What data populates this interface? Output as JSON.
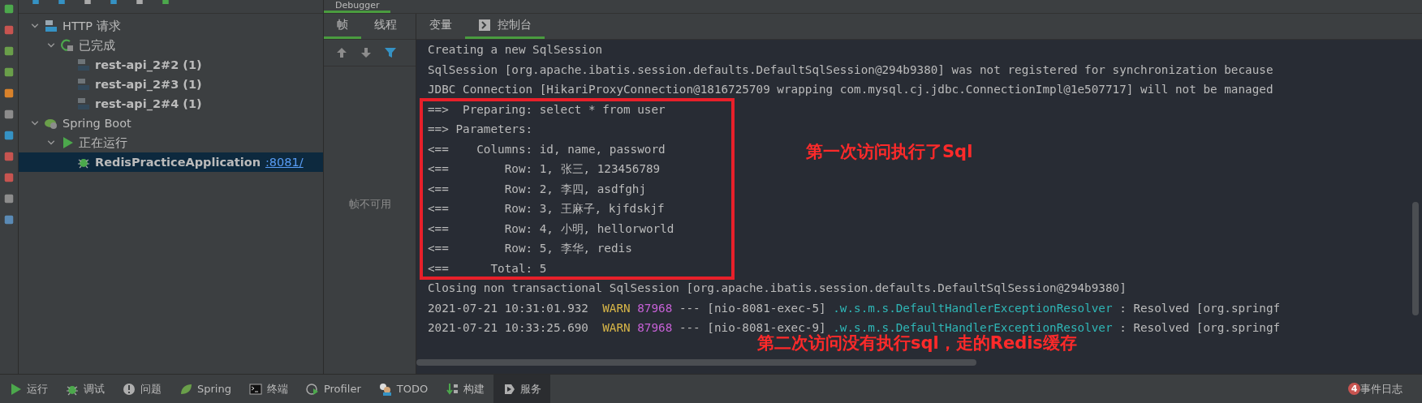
{
  "debugger_tab": {
    "label": "Debugger",
    "selected": true
  },
  "services_tree": [
    {
      "label": "HTTP 请求",
      "kind": "api",
      "expanded": true,
      "selected": false,
      "children": [
        {
          "label": "已完成",
          "kind": "done",
          "expanded": true,
          "selected": false,
          "children": [
            {
              "label": "rest-api_2#2 (1)",
              "kind": "request",
              "selected": false
            },
            {
              "label": "rest-api_2#3 (1)",
              "kind": "request",
              "selected": false
            },
            {
              "label": "rest-api_2#4 (1)",
              "kind": "request",
              "selected": false
            }
          ]
        }
      ]
    },
    {
      "label": "Spring Boot",
      "kind": "spring",
      "expanded": true,
      "selected": false,
      "children": [
        {
          "label": "正在运行",
          "kind": "running",
          "expanded": true,
          "selected": false,
          "children": [
            {
              "label": "RedisPracticeApplication",
              "link": ":8081/",
              "kind": "app",
              "selected": true
            }
          ]
        }
      ]
    }
  ],
  "frames_tabs": [
    {
      "label": "帧",
      "selected": true
    },
    {
      "label": "线程",
      "selected": false
    }
  ],
  "frames_empty": "帧不可用",
  "console_tabs": [
    {
      "label": "变量",
      "selected": false
    },
    {
      "label": "控制台",
      "selected": true
    }
  ],
  "console_lines": [
    [
      {
        "text": "Creating a new SqlSession",
        "kind": "plain"
      }
    ],
    [
      {
        "text": "SqlSession [org.apache.ibatis.session.defaults.DefaultSqlSession@294b9380] was not registered for synchronization because",
        "kind": "plain"
      }
    ],
    [
      {
        "text": "JDBC Connection [HikariProxyConnection@1816725709 wrapping com.mysql.cj.jdbc.ConnectionImpl@1e507717] will not be managed",
        "kind": "plain"
      }
    ],
    [
      {
        "text": "==>  Preparing: select * from user",
        "kind": "plain"
      }
    ],
    [
      {
        "text": "==> Parameters: ",
        "kind": "plain"
      }
    ],
    [
      {
        "text": "<==    Columns: id, name, password",
        "kind": "plain"
      }
    ],
    [
      {
        "text": "<==        Row: 1, 张三, 123456789",
        "kind": "plain"
      }
    ],
    [
      {
        "text": "<==        Row: 2, 李四, asdfghj",
        "kind": "plain"
      }
    ],
    [
      {
        "text": "<==        Row: 3, 王麻子, kjfdskjf",
        "kind": "plain"
      }
    ],
    [
      {
        "text": "<==        Row: 4, 小明, hellorworld",
        "kind": "plain"
      }
    ],
    [
      {
        "text": "<==        Row: 5, 李华, redis",
        "kind": "plain"
      }
    ],
    [
      {
        "text": "<==      Total: 5",
        "kind": "plain"
      }
    ],
    [
      {
        "text": "Closing non transactional SqlSession [org.apache.ibatis.session.defaults.DefaultSqlSession@294b9380]",
        "kind": "plain"
      }
    ],
    [
      {
        "text": "2021-07-21 10:31:01.932  ",
        "kind": "plain"
      },
      {
        "text": "WARN ",
        "kind": "warn"
      },
      {
        "text": "87968",
        "kind": "pid"
      },
      {
        "text": " --- [nio-8081-exec-5] ",
        "kind": "plain"
      },
      {
        "text": ".w.s.m.s.DefaultHandlerExceptionResolver",
        "kind": "logger"
      },
      {
        "text": " : Resolved [org.springf",
        "kind": "plain"
      }
    ],
    [
      {
        "text": "2021-07-21 10:33:25.690  ",
        "kind": "plain"
      },
      {
        "text": "WARN ",
        "kind": "warn"
      },
      {
        "text": "87968",
        "kind": "pid"
      },
      {
        "text": " --- [nio-8081-exec-9] ",
        "kind": "plain"
      },
      {
        "text": ".w.s.m.s.DefaultHandlerExceptionResolver",
        "kind": "logger"
      },
      {
        "text": " : Resolved [org.springf",
        "kind": "plain"
      }
    ]
  ],
  "annotations": [
    "第一次访问执行了Sql",
    "第二次访问没有执行sql，走的Redis缓存"
  ],
  "bottom_tools": [
    {
      "label": "运行",
      "kind": "run",
      "selected": false
    },
    {
      "label": "调试",
      "kind": "debug",
      "selected": false
    },
    {
      "label": "问题",
      "kind": "problems",
      "selected": false
    },
    {
      "label": "Spring",
      "kind": "spring",
      "selected": false
    },
    {
      "label": "终端",
      "kind": "terminal",
      "selected": false
    },
    {
      "label": "Profiler",
      "kind": "profiler",
      "selected": false
    },
    {
      "label": "TODO",
      "kind": "todo",
      "selected": false
    },
    {
      "label": "构建",
      "kind": "build",
      "selected": false
    },
    {
      "label": "服务",
      "kind": "services",
      "selected": true
    }
  ],
  "event_log": {
    "count": "4",
    "label": "事件日志"
  }
}
